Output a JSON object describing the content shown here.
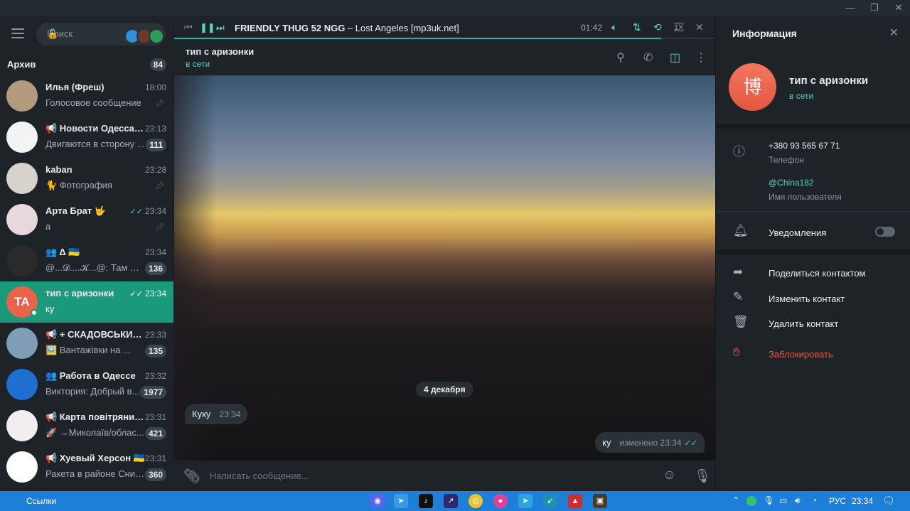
{
  "window": {
    "minimize": "—",
    "restore": "❐",
    "close": "✕"
  },
  "sidebar": {
    "search_placeholder": "Поиск",
    "archive_label": "Архив",
    "archive_count": "84",
    "chats": [
      {
        "name": "Илья (Фреш)",
        "time": "18:00",
        "preview": "Голосовое сообщение",
        "pinned": true,
        "avatar_color": "#b29b7c",
        "initials": ""
      },
      {
        "name": "📢 Новости Одесса | Одесса",
        "time": "23:13",
        "preview": "Двигаются в сторону ...",
        "badge": "111",
        "avatar_color": "#f3f3f3",
        "initials": ""
      },
      {
        "name": "kaban",
        "time": "23:28",
        "preview": "🐈 Фотография",
        "pinned": true,
        "avatar_color": "#d8d2cc",
        "initials": ""
      },
      {
        "name": "Арта Брат 🤟",
        "time": "23:34",
        "preview": "а",
        "pinned": true,
        "read": true,
        "avatar_color": "#e6d8dc",
        "initials": ""
      },
      {
        "name": "👥 Δ 🇺🇦",
        "time": "23:34",
        "preview": "@...𝓓....𝓚...@: Там ще ...",
        "badge": "136",
        "avatar_color": "#2a2a2a",
        "initials": ""
      },
      {
        "name": "тип с аризонки",
        "time": "23:34",
        "preview": "ку",
        "read": true,
        "active": true,
        "avatar_color": "#e9634a",
        "initials": "TA"
      },
      {
        "name": "📢 + СКАДОВСЬКИЙ ...",
        "time": "23:33",
        "preview": "🖼️ Вантажівки на ...",
        "badge": "135",
        "avatar_color": "#7f9db4",
        "initials": ""
      },
      {
        "name": "👥 Работа в Одессе",
        "time": "23:32",
        "preview": "Виктория: Добрый в...",
        "badge": "1977",
        "avatar_color": "#1f6fd0",
        "initials": ""
      },
      {
        "name": "📢 Карта повітряних тривог",
        "time": "23:31",
        "preview": "🚀 →Миколаїв/облас...",
        "badge": "421",
        "avatar_color": "#f0eeee",
        "initials": ""
      },
      {
        "name": "📢 Хуевый Херсон 🇺🇦",
        "time": "23:31",
        "preview": "Ракета в районе Снигирёвки",
        "badge": "360",
        "avatar_color": "#ffffff",
        "initials": ""
      }
    ]
  },
  "player": {
    "track": "FRIENDLY THUG 52 NGG",
    "separator": " – ",
    "song": "Lost Angeles [mp3uk.net]",
    "time": "01:42",
    "speed": "1X",
    "progress": 0.9
  },
  "chat": {
    "title": "тип с аризонки",
    "status": "в сети",
    "date_chip": "4 декабря",
    "messages": [
      {
        "text": "Куку",
        "time": "23:34",
        "direction": "in"
      },
      {
        "text": "ку",
        "time": "изменено 23:34",
        "direction": "out",
        "read": true
      }
    ],
    "compose_placeholder": "Написать сообщение..."
  },
  "info": {
    "header": "Информация",
    "avatar_glyph": "博",
    "name": "тип с аризонки",
    "status": "в сети",
    "phone": "+380 93 565 67 71",
    "phone_label": "Телефон",
    "username": "@China182",
    "username_label": "Имя пользователя",
    "notifications": "Уведомления",
    "share": "Поделиться контактом",
    "edit": "Изменить контакт",
    "delete": "Удалить контакт",
    "block": "Заблокировать"
  },
  "taskbar": {
    "links": "Ссылки",
    "lang": "РУС",
    "clock": "23:34"
  },
  "colors": {
    "accent": "#5ad4b4",
    "active_chat": "#1a9a7a",
    "danger": "#e25c4a",
    "taskbar": "#1e7fd8"
  }
}
